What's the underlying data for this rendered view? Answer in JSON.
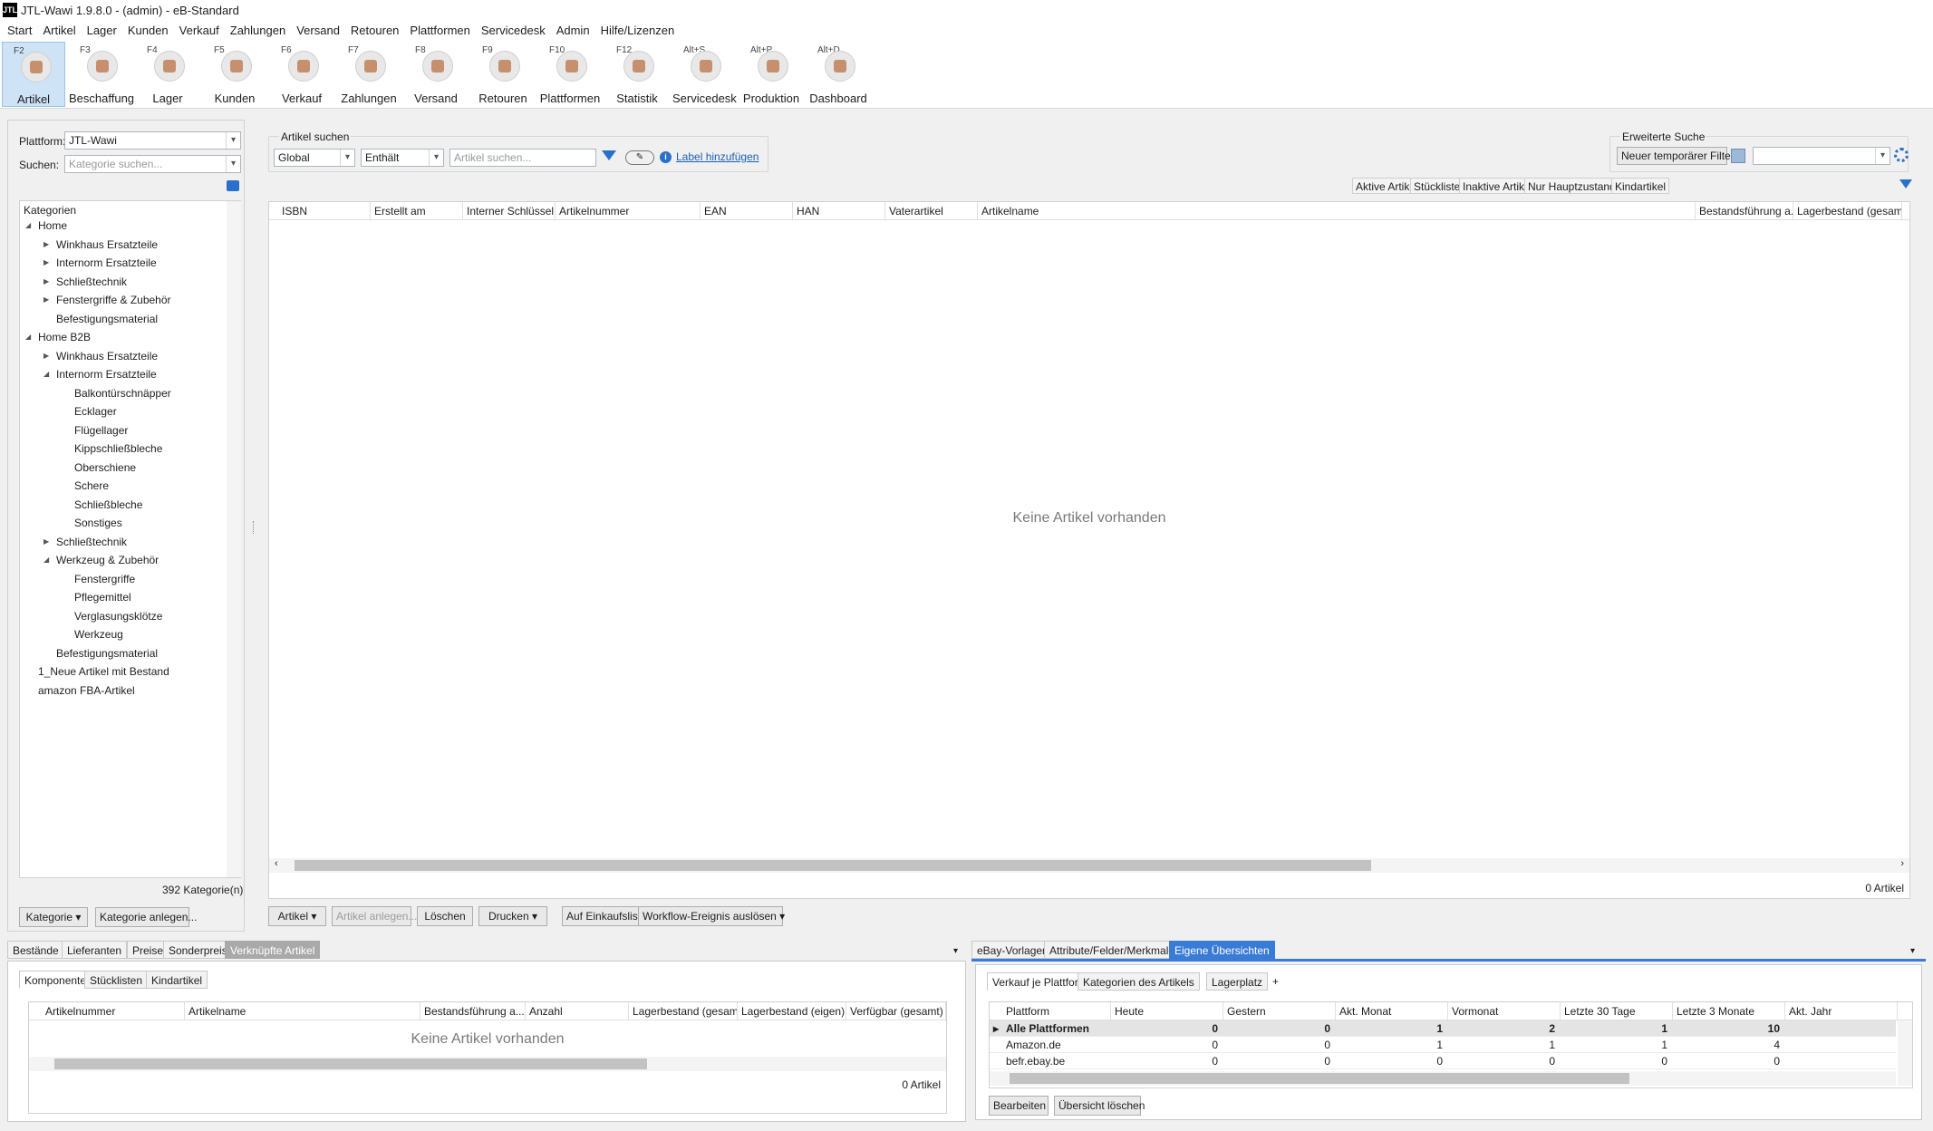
{
  "window": {
    "title": "JTL-Wawi 1.9.8.0 - (admin) - eB-Standard",
    "logo_text": "JTL"
  },
  "menu": [
    "Start",
    "Artikel",
    "Lager",
    "Kunden",
    "Verkauf",
    "Zahlungen",
    "Versand",
    "Retouren",
    "Plattformen",
    "Servicedesk",
    "Admin",
    "Hilfe/Lizenzen"
  ],
  "toolbar": [
    {
      "key": "F2",
      "label": "Artikel",
      "active": true
    },
    {
      "key": "F3",
      "label": "Beschaffung"
    },
    {
      "key": "F4",
      "label": "Lager"
    },
    {
      "key": "F5",
      "label": "Kunden"
    },
    {
      "key": "F6",
      "label": "Verkauf"
    },
    {
      "key": "F7",
      "label": "Zahlungen"
    },
    {
      "key": "F8",
      "label": "Versand"
    },
    {
      "key": "F9",
      "label": "Retouren"
    },
    {
      "key": "F10",
      "label": "Plattformen"
    },
    {
      "key": "F12",
      "label": "Statistik"
    },
    {
      "key": "Alt+S",
      "label": "Servicedesk"
    },
    {
      "key": "Alt+P",
      "label": "Produktion"
    },
    {
      "key": "Alt+D",
      "label": "Dashboard"
    }
  ],
  "left": {
    "plattform_label": "Plattform:",
    "plattform_value": "JTL-Wawi",
    "suchen_label": "Suchen:",
    "suchen_placeholder": "Kategorie suchen...",
    "tree_header": "Kategorien",
    "tree": [
      {
        "label": "Home",
        "level": 0,
        "toggle": "open"
      },
      {
        "label": "Winkhaus Ersatzteile",
        "level": 1,
        "toggle": "closed"
      },
      {
        "label": "Internorm Ersatzteile",
        "level": 1,
        "toggle": "closed"
      },
      {
        "label": "Schließtechnik",
        "level": 1,
        "toggle": "closed"
      },
      {
        "label": "Fenstergriffe & Zubehör",
        "level": 1,
        "toggle": "closed"
      },
      {
        "label": "Befestigungsmaterial",
        "level": 1,
        "toggle": "none"
      },
      {
        "label": "Home B2B",
        "level": 0,
        "toggle": "open"
      },
      {
        "label": "Winkhaus Ersatzteile",
        "level": 1,
        "toggle": "closed"
      },
      {
        "label": "Internorm Ersatzteile",
        "level": 1,
        "toggle": "open"
      },
      {
        "label": "Balkontürschnäpper",
        "level": 2,
        "toggle": "none"
      },
      {
        "label": "Ecklager",
        "level": 2,
        "toggle": "none"
      },
      {
        "label": "Flügellager",
        "level": 2,
        "toggle": "none"
      },
      {
        "label": "Kippschließbleche",
        "level": 2,
        "toggle": "none"
      },
      {
        "label": "Oberschiene",
        "level": 2,
        "toggle": "none"
      },
      {
        "label": "Schere",
        "level": 2,
        "toggle": "none"
      },
      {
        "label": "Schließbleche",
        "level": 2,
        "toggle": "none"
      },
      {
        "label": "Sonstiges",
        "level": 2,
        "toggle": "none"
      },
      {
        "label": "Schließtechnik",
        "level": 1,
        "toggle": "closed"
      },
      {
        "label": "Werkzeug & Zubehör",
        "level": 1,
        "toggle": "open"
      },
      {
        "label": "Fenstergriffe",
        "level": 2,
        "toggle": "none"
      },
      {
        "label": "Pflegemittel",
        "level": 2,
        "toggle": "none"
      },
      {
        "label": "Verglasungsklötze",
        "level": 2,
        "toggle": "none"
      },
      {
        "label": "Werkzeug",
        "level": 2,
        "toggle": "none"
      },
      {
        "label": "Befestigungsmaterial",
        "level": 1,
        "toggle": "none"
      },
      {
        "label": "1_Neue Artikel mit Bestand",
        "level": 0,
        "toggle": "none"
      },
      {
        "label": "amazon FBA-Artikel",
        "level": 0,
        "toggle": "none"
      }
    ],
    "count": "392 Kategorie(n)",
    "btn_kategorie": "Kategorie",
    "btn_kategorie_anlegen": "Kategorie anlegen..."
  },
  "search": {
    "group_label": "Artikel suchen",
    "scope": "Global",
    "mode": "Enthält",
    "placeholder": "Artikel suchen...",
    "label_link": "Label hinzufügen",
    "erweiterte_label": "Erweiterte Suche",
    "temp_filter_btn": "Neuer temporärer Filter",
    "quick_filters": [
      "Aktive Artikel",
      "Stücklisten",
      "Inaktive Artikel",
      "Nur Hauptzustand",
      "Kindartikel"
    ]
  },
  "grid": {
    "columns": [
      "ISBN",
      "Erstellt am",
      "Interner Schlüssel",
      "Artikelnummer",
      "EAN",
      "HAN",
      "Vaterartikel",
      "Artikelname",
      "Bestandsführung a...",
      "Lagerbestand (gesamt)"
    ],
    "empty": "Keine Artikel vorhanden",
    "count": "0 Artikel"
  },
  "actions": [
    "Artikel",
    "Artikel anlegen...",
    "Löschen",
    "Drucken",
    "Auf Einkaufsliste setzen...",
    "Workflow-Ereignis auslösen"
  ],
  "bottom_left": {
    "tabs": [
      "Bestände",
      "Lieferanten",
      "Preise",
      "Sonderpreise",
      "Verknüpfte Artikel"
    ],
    "subtabs": [
      "Komponenten",
      "Stücklisten",
      "Kindartikel"
    ],
    "columns": [
      "Artikelnummer",
      "Artikelname",
      "Bestandsführung a...",
      "Anzahl",
      "Lagerbestand (gesamt)",
      "Lagerbestand (eigen)",
      "Verfügbar (gesamt)"
    ],
    "empty": "Keine Artikel vorhanden",
    "count": "0 Artikel"
  },
  "bottom_right": {
    "tabs": [
      "eBay-Vorlagen",
      "Attribute/Felder/Merkmale",
      "Eigene Übersichten"
    ],
    "subtabs": [
      "Verkauf je Plattform",
      "Kategorien des Artikels",
      "Lagerplatz",
      "+"
    ],
    "columns": [
      "Plattform",
      "Heute",
      "Gestern",
      "Akt. Monat",
      "Vormonat",
      "Letzte 30 Tage",
      "Letzte 3 Monate",
      "Akt. Jahr"
    ],
    "rows": [
      {
        "name": "Alle Plattformen",
        "values": [
          "0",
          "0",
          "1",
          "2",
          "1",
          "10"
        ]
      },
      {
        "name": "Amazon.de",
        "values": [
          "0",
          "0",
          "1",
          "1",
          "1",
          "4"
        ]
      },
      {
        "name": "befr.ebay.be",
        "values": [
          "0",
          "0",
          "0",
          "0",
          "0",
          "0"
        ]
      }
    ],
    "btn_bearbeiten": "Bearbeiten",
    "btn_loeschen": "Übersicht löschen"
  }
}
